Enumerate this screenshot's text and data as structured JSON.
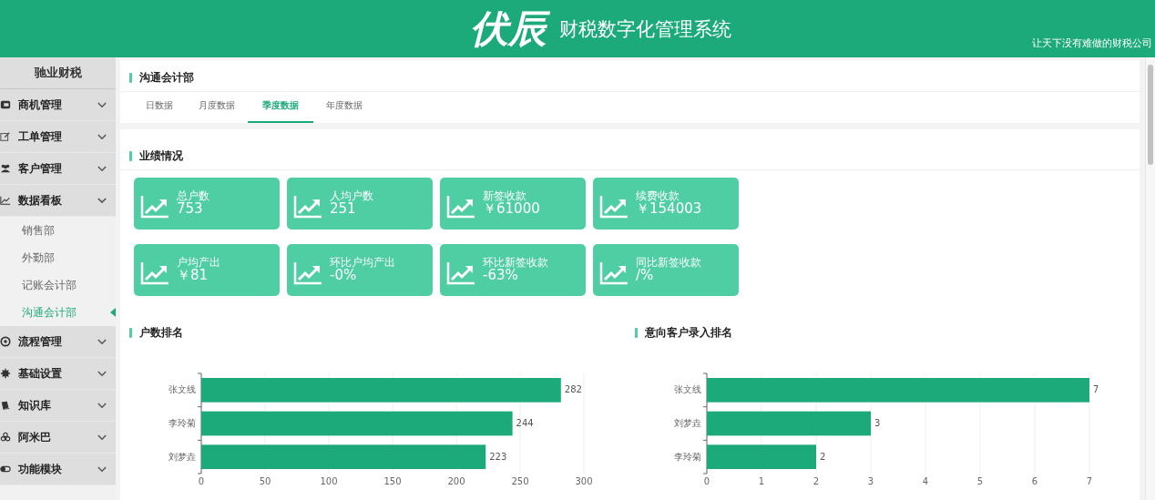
{
  "header": {
    "logo": "伏辰",
    "system_title": "财税数字化管理系统",
    "slogan": "让天下没有难做的财税公司"
  },
  "sidebar": {
    "title": "驰业财税",
    "items": [
      {
        "label": "商机管理",
        "expanded": false
      },
      {
        "label": "工单管理",
        "expanded": false
      },
      {
        "label": "客户管理",
        "expanded": false
      },
      {
        "label": "数据看板",
        "expanded": true,
        "children": [
          {
            "label": "销售部",
            "selected": false
          },
          {
            "label": "外勤部",
            "selected": false
          },
          {
            "label": "记账会计部",
            "selected": false
          },
          {
            "label": "沟通会计部",
            "selected": true
          }
        ]
      },
      {
        "label": "流程管理",
        "expanded": false
      },
      {
        "label": "基础设置",
        "expanded": false
      },
      {
        "label": "知识库",
        "expanded": false
      },
      {
        "label": "阿米巴",
        "expanded": false
      },
      {
        "label": "功能模块",
        "expanded": false
      }
    ]
  },
  "department": {
    "title": "沟通会计部",
    "tabs": [
      {
        "label": "日数据",
        "selected": false
      },
      {
        "label": "月度数据",
        "selected": false
      },
      {
        "label": "季度数据",
        "selected": true
      },
      {
        "label": "年度数据",
        "selected": false
      }
    ]
  },
  "performance": {
    "title": "业绩情况",
    "cards": [
      {
        "label": "总户数",
        "value": "753"
      },
      {
        "label": "人均户数",
        "value": "251"
      },
      {
        "label": "新签收款",
        "value": "￥61000"
      },
      {
        "label": "续费收款",
        "value": "￥154003"
      },
      {
        "label": "户均产出",
        "value": "￥81"
      },
      {
        "label": "环比户均产出",
        "value": "-0%"
      },
      {
        "label": "环比新签收款",
        "value": "-63%"
      },
      {
        "label": "同比新签收款",
        "value": "/%"
      }
    ]
  },
  "rankings": [
    {
      "title": "户数排名",
      "chart_data": {
        "type": "bar",
        "orientation": "horizontal",
        "categories": [
          "张文线",
          "李玲菊",
          "刘梦垚"
        ],
        "series": [
          {
            "color": "#1daa7a",
            "values": [
              282,
              244,
              223
            ]
          }
        ],
        "grid": true,
        "xlim": [
          0,
          300
        ],
        "xticks": [
          0,
          50,
          100,
          150,
          200,
          250,
          300
        ],
        "data_labels": true
      }
    },
    {
      "title": "意向客户录入排名",
      "chart_data": {
        "type": "bar",
        "orientation": "horizontal",
        "categories": [
          "张文线",
          "刘梦垚",
          "李玲菊"
        ],
        "series": [
          {
            "color": "#1daa7a",
            "values": [
              7,
              3,
              2
            ]
          }
        ],
        "grid": true,
        "xlim": [
          0,
          7
        ],
        "xticks": [
          0,
          1,
          2,
          3,
          4,
          5,
          6,
          7
        ],
        "data_labels": true
      }
    }
  ]
}
